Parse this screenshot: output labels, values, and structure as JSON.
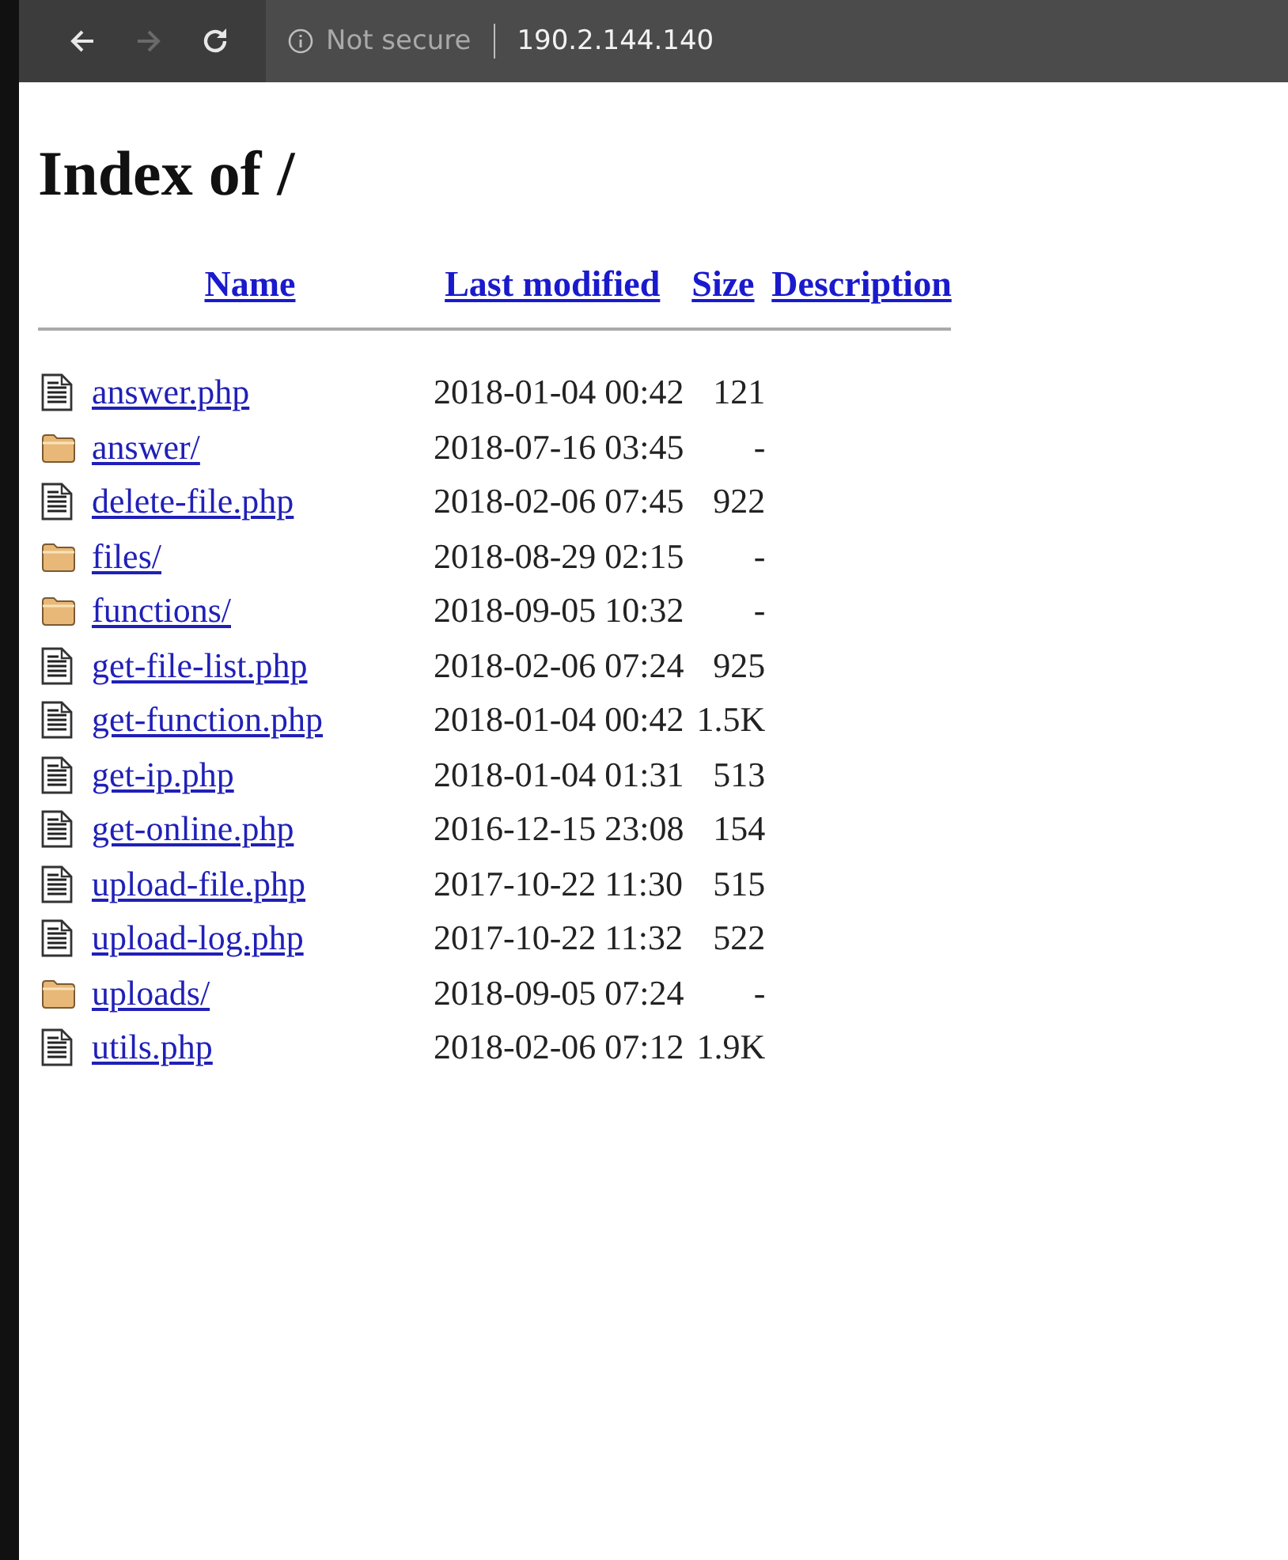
{
  "browser": {
    "security_label": "Not secure",
    "address": "190.2.144.140"
  },
  "page": {
    "heading": "Index of /"
  },
  "table": {
    "columns": [
      "Name",
      "Last modified",
      "Size",
      "Description"
    ],
    "rows": [
      {
        "kind": "file",
        "name": "answer.php",
        "modified": "2018-01-04 00:42",
        "size": "121"
      },
      {
        "kind": "folder",
        "name": "answer/",
        "modified": "2018-07-16 03:45",
        "size": "-"
      },
      {
        "kind": "file",
        "name": "delete-file.php",
        "modified": "2018-02-06 07:45",
        "size": "922"
      },
      {
        "kind": "folder",
        "name": "files/",
        "modified": "2018-08-29 02:15",
        "size": "-"
      },
      {
        "kind": "folder",
        "name": "functions/",
        "modified": "2018-09-05 10:32",
        "size": "-"
      },
      {
        "kind": "file",
        "name": "get-file-list.php",
        "modified": "2018-02-06 07:24",
        "size": "925"
      },
      {
        "kind": "file",
        "name": "get-function.php",
        "modified": "2018-01-04 00:42",
        "size": "1.5K"
      },
      {
        "kind": "file",
        "name": "get-ip.php",
        "modified": "2018-01-04 01:31",
        "size": "513"
      },
      {
        "kind": "file",
        "name": "get-online.php",
        "modified": "2016-12-15 23:08",
        "size": "154"
      },
      {
        "kind": "file",
        "name": "upload-file.php",
        "modified": "2017-10-22 11:30",
        "size": "515"
      },
      {
        "kind": "file",
        "name": "upload-log.php",
        "modified": "2017-10-22 11:32",
        "size": "522"
      },
      {
        "kind": "folder",
        "name": "uploads/",
        "modified": "2018-09-05 07:24",
        "size": "-"
      },
      {
        "kind": "file",
        "name": "utils.php",
        "modified": "2018-02-06 07:12",
        "size": "1.9K"
      }
    ]
  }
}
